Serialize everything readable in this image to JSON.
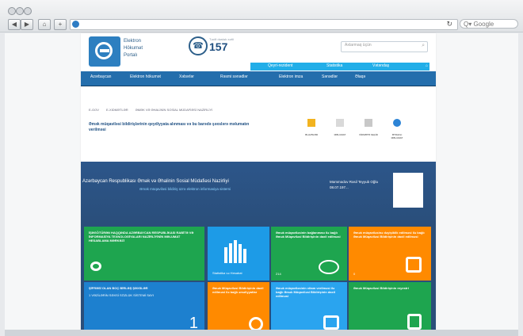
{
  "browser": {
    "search_placeholder": "Q▾ Google"
  },
  "site": {
    "logo_text": [
      "Elektron",
      "Hökumət",
      "Portalı"
    ],
    "phone_label": "Təcili dəstək xətti",
    "phone_number": "157",
    "search_placeholder": "Axtarmaq üçün",
    "topbar": [
      "Qeyri-rezident",
      "Statistika",
      "Vətəndaş"
    ],
    "mainnav": [
      "Azərbaycan",
      "Elektron hökumət",
      "Xəbərlər",
      "Rəsmi sənədlər",
      "Elektron imza",
      "Sənədlər",
      "Əlaqə"
    ],
    "breadcrumbs": [
      "E-GOV",
      "E-XIDMƏTLƏR",
      "ƏMƏK VƏ ƏHALİNİN SOSİAL MÜDAFİƏSİ NAZİRLİYİ"
    ],
    "intro": "Əmək müqaviləsi bildirişlərinin qeydiyyata alınması və bu barədə şəxslərə məlumatın verilməsi",
    "actions": [
      "ƏLAVƏLƏR",
      "MƏLUMAT",
      "XİDMƏTƏ KEÇİD",
      "ƏTRAFLI MƏLUMAT"
    ],
    "hero": {
      "title": "Azərbaycan Respublikası Əmək və Əhalinin Sosial Müdafiəsi Nazirliyi",
      "subtitle": "Əmək müqaviləsi bildiriş üzrə elektron informasiya sistemi",
      "right_line1": "Məmmədov Rəsil Teyyub Oğlu",
      "right_line2": "08.07.197..."
    },
    "tiles": {
      "g1": "İŞƏGÖTÜRƏN HAQQINDA AZƏRBAYCAN RESPUBLİKASI RABİTƏ VƏ İNFORMASİYA TEXNOLOGİYALARI NAZİRLİYİNİN MƏLUMAT HESABLAMA MƏRKƏZİ",
      "b1": "Statistika və Hesabat",
      "g2": "Əmək müqaviləsinin bağlanması ilə bağlı Əmək Müqaviləsi Bildirişinin daxil edilməsi",
      "g2_number": "214",
      "o1": "Əmək müqaviləsinə dəyişiklik edilməsi ilə bağlı Əmək Müqaviləsi Bildirişinin daxil edilməsi",
      "o1_number": "0",
      "b2": "ŞİFRƏSİ OLAN BOÇ BİRLƏŞ ŞƏXSLƏR",
      "b2_sub": "1 VƏZİLƏRİN SƏXSİ SÖZLÜK SİSTEMİ SAYI",
      "b2_number": "1",
      "o2": "Əmək Müqaviləsi Bildirişinin daxil edilməsi ilə bağlı əməliyyatlar",
      "c1": "Əmək müqaviləsinin xitam verilməsi ilə bağlı Əmək Müqaviləsi Bildirişinin daxil edilməsi",
      "g3": "Əmək Müqaviləsi Bildirişinin reyestri"
    }
  }
}
